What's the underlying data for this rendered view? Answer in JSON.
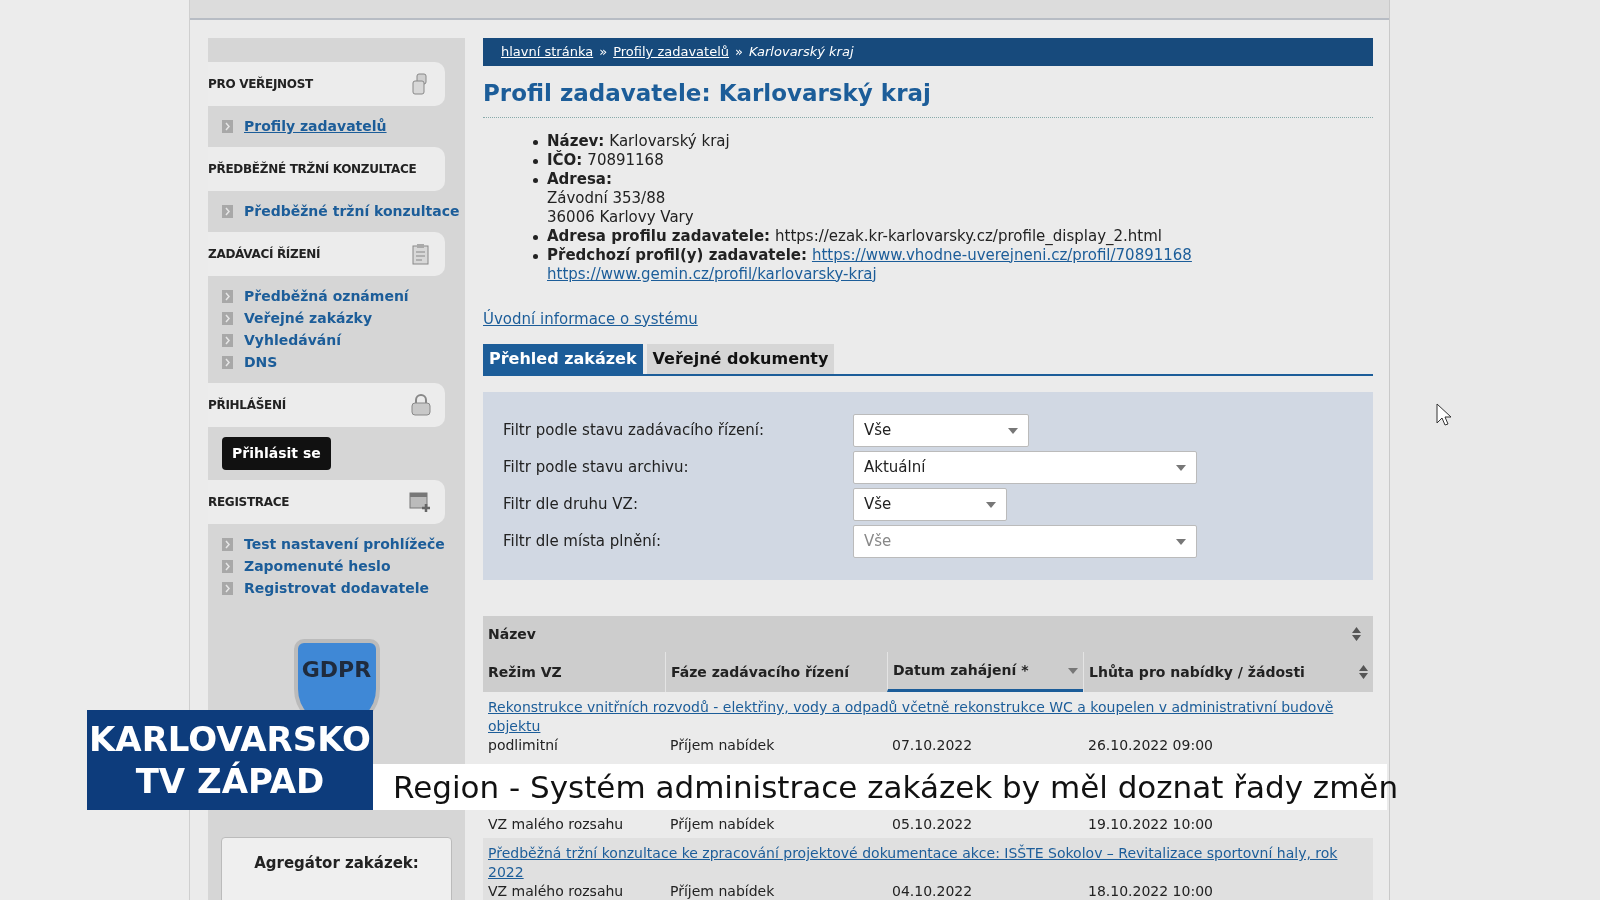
{
  "breadcrumb": [
    {
      "label": "hlavní stránka",
      "kind": "link"
    },
    {
      "label": "»",
      "kind": "sep"
    },
    {
      "label": "Profily zadavatelů",
      "kind": "link"
    },
    {
      "label": "»",
      "kind": "sep"
    },
    {
      "label": "Karlovarský kraj",
      "kind": "current"
    }
  ],
  "sidebar": {
    "sections": [
      {
        "title": "PRO VEŘEJNOST",
        "links": [
          "Profily zadavatelů"
        ]
      },
      {
        "title": "PŘEDBĚŽNÉ TRŽNÍ KONZULTACE",
        "links": [
          "Předběžné tržní konzultace"
        ]
      },
      {
        "title": "ZADÁVACÍ ŘÍZENÍ",
        "links": [
          "Předběžná oznámení",
          "Veřejné zakázky",
          "Vyhledávání",
          "DNS"
        ]
      },
      {
        "title": "PŘIHLÁŠENÍ",
        "button": "Přihlásit se"
      },
      {
        "title": "REGISTRACE",
        "links": [
          "Test nastavení prohlížeče",
          "Zapomenuté heslo",
          "Registrovat dodavatele"
        ]
      }
    ],
    "badge": "GDPR",
    "aggregator": "Agregátor zakázek:"
  },
  "title": "Profil zadavatele: Karlovarský kraj",
  "details": [
    {
      "label": "Název:",
      "lines": [
        "Karlovarský kraj"
      ]
    },
    {
      "label": "IČO:",
      "lines": [
        "70891168"
      ]
    },
    {
      "label": "Adresa:",
      "lines": [
        "Závodní 353/88",
        "36006 Karlovy Vary"
      ]
    },
    {
      "label": "Adresa profilu zadavatele:",
      "lines": [
        "https://ezak.kr-karlovarsky.cz/profile_display_2.html"
      ]
    },
    {
      "label": "Předchozí profil(y) zadavatele:",
      "links": [
        "https://www.vhodne-uverejneni.cz/profil/70891168",
        "https://www.gemin.cz/profil/karlovarsky-kraj"
      ]
    }
  ],
  "intro_link": "Úvodní informace o systému",
  "tabs": [
    {
      "label": "Přehled zakázek",
      "selected": true
    },
    {
      "label": "Veřejné dokumenty",
      "selected": false
    }
  ],
  "filters": [
    {
      "label": "Filtr podle stavu zadávacího řízení:",
      "value": "Vše",
      "disabled": false
    },
    {
      "label": "Filtr podle stavu archivu:",
      "value": "Aktuální",
      "disabled": false
    },
    {
      "label": "Filtr dle druhu VZ:",
      "value": "Vše",
      "disabled": false
    },
    {
      "label": "Filtr dle místa plnění:",
      "value": "Vše",
      "disabled": true
    }
  ],
  "table": {
    "title_column": "Název",
    "columns": [
      {
        "label": "Režim VZ",
        "selected": false
      },
      {
        "label": "Fáze zadávacího řízení",
        "selected": false
      },
      {
        "label": "Datum zahájení *",
        "selected": true
      },
      {
        "label": "Lhůta pro nabídky / žádosti",
        "selected": false
      }
    ],
    "rows": [
      {
        "title": "Rekonstrukce vnitřních rozvodů - elektřiny, vody a odpadů včetně rekonstrukce WC a koupelen v administrativní budově objektu",
        "cells": [
          "podlimitní",
          "Příjem nabídek",
          "07.10.2022",
          "26.10.2022 09:00"
        ]
      },
      {
        "cells": [
          "VZ malého rozsahu",
          "Příjem nabídek",
          "05.10.2022",
          "19.10.2022 10:00"
        ]
      },
      {
        "title": "Předběžná tržní konzultace ke zpracování projektové dokumentace akce: ISŠTE Sokolov – Revitalizace sportovní haly, rok 2022",
        "cells": [
          "VZ malého rozsahu",
          "Příjem nabídek",
          "04.10.2022",
          "18.10.2022 10:00"
        ]
      }
    ]
  },
  "tv_overlay": {
    "channel": [
      "KARLOVARSKO",
      "TV ZÁPAD"
    ],
    "headline": "Region - Systém administrace zakázek by měl doznat řady změn"
  }
}
